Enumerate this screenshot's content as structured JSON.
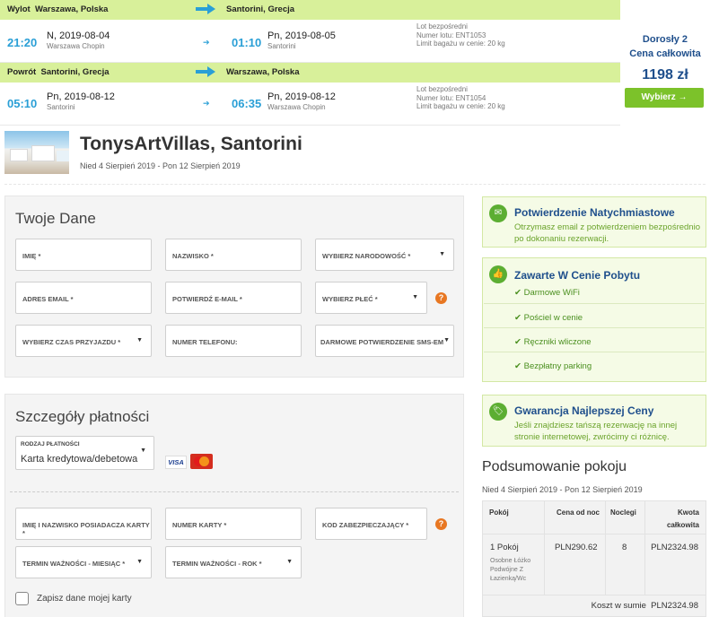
{
  "outbound": {
    "header_label": "Wylot",
    "from": "Warszawa, Polska",
    "to": "Santorini, Grecja",
    "dep_time": "21:20",
    "dep_day": "N",
    "dep_date": "2019-08-04",
    "dep_place": "Warszawa Chopin",
    "arr_time": "01:10",
    "arr_day": "Pn",
    "arr_date": "2019-08-05",
    "arr_place": "Santorini",
    "lot_type": "Lot bezpośredni",
    "flight_no": "Numer lotu: ENT1053",
    "baggage": "Limit bagażu w cenie: 20 kg"
  },
  "return": {
    "header_label": "Powrót",
    "from": "Santorini, Grecja",
    "to": "Warszawa, Polska",
    "dep_time": "05:10",
    "dep_day": "Pn",
    "dep_date": "2019-08-12",
    "dep_place": "Santorini",
    "arr_time": "06:35",
    "arr_day": "Pn",
    "arr_date": "2019-08-12",
    "arr_place": "Warszawa Chopin",
    "lot_type": "Lot bezpośredni",
    "flight_no": "Numer lotu: ENT1054",
    "baggage": "Limit bagażu w cenie: 20 kg"
  },
  "pricebox": {
    "pax": "Dorosły 2",
    "total_label": "Cena całkowita",
    "price": "1198 zł",
    "select_label": "Wybierz →"
  },
  "hotel": {
    "name": "TonysArtVillas, Santorini",
    "dates": "Nied 4 Sierpień 2019 - Pon 12 Sierpień 2019"
  },
  "your_data": {
    "title": "Twoje Dane",
    "first_name": "IMIĘ *",
    "last_name": "NAZWISKO *",
    "nationality": "WYBIERZ NARODOWOŚĆ *",
    "email": "ADRES EMAIL *",
    "email_confirm": "POTWIERDŹ E-MAIL *",
    "gender": "WYBIERZ PŁEĆ *",
    "arrival_time": "WYBIERZ CZAS PRZYJAZDU *",
    "phone": "NUMER TELEFONU:",
    "sms": "DARMOWE POTWIERDZENIE SMS-EM"
  },
  "payment": {
    "title": "Szczegóły płatności",
    "type_label": "RODZAJ PŁATNOŚCI",
    "type_value": "Karta kredytowa/debetowa",
    "visa": "VISA",
    "holder": "IMIĘ I NAZWISKO POSIADACZA KARTY *",
    "card_no": "NUMER KARTY *",
    "cvv": "KOD ZABEZPIECZAJĄCY *",
    "exp_month": "TERMIN WAŻNOŚCI - MIESIĄC *",
    "exp_year": "TERMIN WAŻNOŚCI - ROK *",
    "save_card": "Zapisz dane mojej karty"
  },
  "info": {
    "instant_title": "Potwierdzenie Natychmiastowe",
    "instant_desc": "Otrzymasz email z potwierdzeniem bezpośrednio po dokonaniu rezerwacji.",
    "included_title": "Zawarte W Cenie Pobytu",
    "included_items": [
      "Darmowe WiFi",
      "Pościel w cenie",
      "Ręczniki wliczone",
      "Bezpłatny parking"
    ],
    "best_title": "Gwarancja Najlepszej Ceny",
    "best_desc": "Jeśli znajdziesz tańszą rezerwację na innej stronie internetowej, zwrócimy ci różnicę."
  },
  "summary": {
    "title": "Podsumowanie pokoju",
    "dates": "Nied 4 Sierpień 2019 - Pon 12 Sierpień 2019",
    "col_room": "Pokój",
    "col_price": "Cena od noc",
    "col_nights": "Noclegi",
    "col_total_1": "Kwota",
    "col_total_2": "całkowita",
    "room": "1 Pokój",
    "room_desc_1": "Osobne Łóżko",
    "room_desc_2": "Podwójne Z",
    "room_desc_3": "Łazienką/Wc",
    "price": "PLN290.62",
    "nights": "8",
    "total": "PLN2324.98",
    "sum_label": "Koszt w sumie",
    "sum_value": "PLN2324.98"
  }
}
